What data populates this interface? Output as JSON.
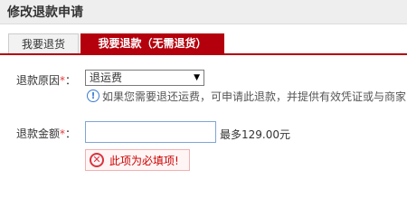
{
  "header": {
    "title": "修改退款申请"
  },
  "tabs": [
    {
      "label": "我要退货",
      "active": false
    },
    {
      "label": "我要退款（无需退货）",
      "active": true
    }
  ],
  "form": {
    "reason": {
      "label": "退款原因",
      "required_mark": "*",
      "colon": "：",
      "selected_value": "退运费",
      "arrow_icon": "dropdown-arrow",
      "hint_icon": "info-icon",
      "hint_text": "如果您需要退还运费，可申请此退款，并提供有效凭证或与商家"
    },
    "amount": {
      "label": "退款金额",
      "required_mark": "*",
      "colon": "：",
      "value": "",
      "max_note": "最多129.00元",
      "error_icon": "error-icon",
      "error_text": "此项为必填项!"
    }
  },
  "colors": {
    "accent": "#b4000c",
    "required": "#e4393c",
    "error": "#cc0000",
    "info": "#3a7bd5"
  }
}
